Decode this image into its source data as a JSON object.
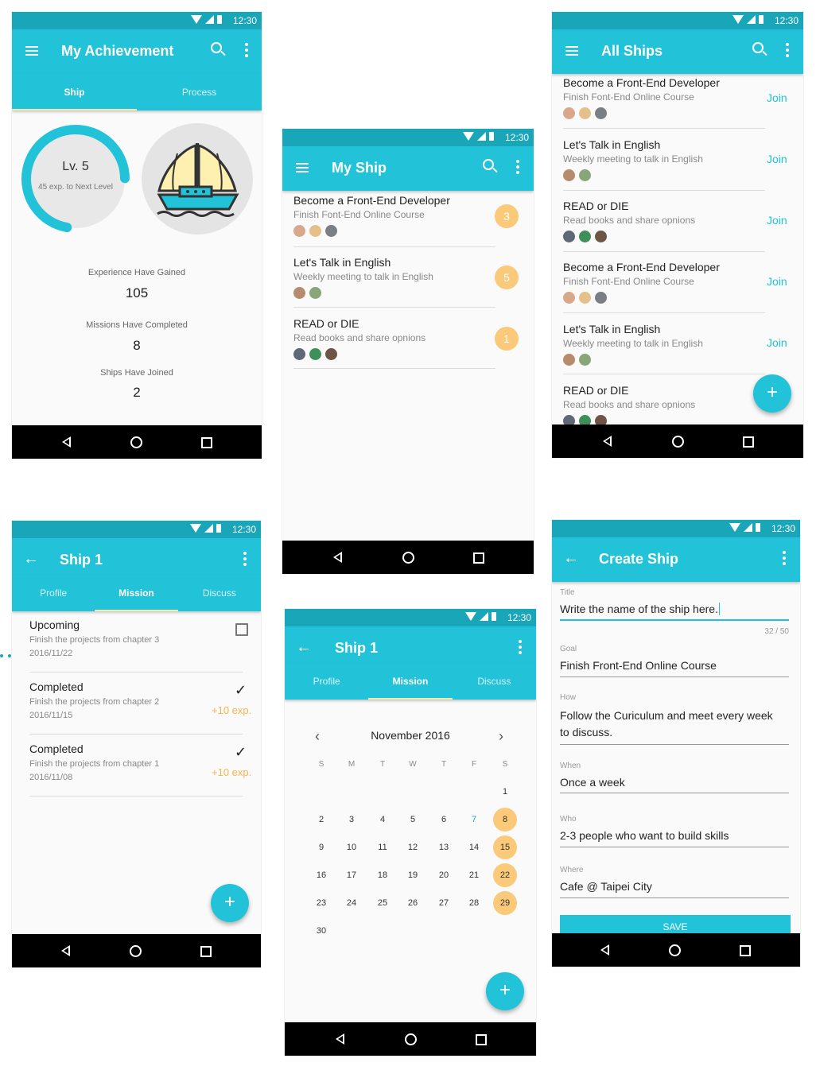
{
  "status_time": "12:30",
  "achievement": {
    "title": "My Achievement",
    "tabs": [
      "Ship",
      "Process"
    ],
    "level": "Lv. 5",
    "next_level": "45 exp. to Next Level",
    "level_progress": 0.72,
    "stats": [
      {
        "label": "Experience Have Gained",
        "value": "105"
      },
      {
        "label": "Missions Have Completed",
        "value": "8"
      },
      {
        "label": "Ships Have Joined",
        "value": "2"
      }
    ]
  },
  "my_ship": {
    "title": "My Ship",
    "items": [
      {
        "title": "Become a Front-End Developer",
        "sub": "Finish Font-End Online Course",
        "badge": "3"
      },
      {
        "title": "Let's Talk in English",
        "sub": "Weekly meeting to talk in English",
        "badge": "5"
      },
      {
        "title": "READ or DIE",
        "sub": "Read books and share opnions",
        "badge": "1"
      }
    ]
  },
  "all_ships": {
    "title": "All Ships",
    "join_label": "Join",
    "items": [
      {
        "title": "Become a Front-End Developer",
        "sub": "Finish Font-End Online Course"
      },
      {
        "title": "Let's Talk in English",
        "sub": "Weekly meeting to talk in English"
      },
      {
        "title": "READ or DIE",
        "sub": "Read books and share opnions"
      },
      {
        "title": "Become a Front-End Developer",
        "sub": "Finish Font-End Online Course"
      },
      {
        "title": "Let's Talk in English",
        "sub": "Weekly meeting to talk in English"
      },
      {
        "title": "READ or DIE",
        "sub": "Read books and share opnions"
      }
    ]
  },
  "ship1_mission": {
    "title": "Ship 1",
    "tabs": [
      "Profile",
      "Mission",
      "Discuss"
    ],
    "items": [
      {
        "status": "Upcoming",
        "desc": "Finish the projects from chapter 3",
        "date": "2016/11/22",
        "exp": ""
      },
      {
        "status": "Completed",
        "desc": "Finish the projects from chapter 2",
        "date": "2016/11/15",
        "exp": "+10 exp."
      },
      {
        "status": "Completed",
        "desc": "Finish the projects from chapter 1",
        "date": "2016/11/08",
        "exp": "+10 exp."
      }
    ],
    "fab": "+"
  },
  "ship1_calendar": {
    "title": "Ship 1",
    "tabs": [
      "Profile",
      "Mission",
      "Discuss"
    ],
    "month": "November 2016",
    "weekdays": [
      "S",
      "M",
      "T",
      "W",
      "T",
      "F",
      "S"
    ],
    "days": [
      "1",
      "2",
      "3",
      "4",
      "5",
      "6",
      "7",
      "8",
      "9",
      "10",
      "11",
      "12",
      "13",
      "14",
      "15",
      "16",
      "17",
      "18",
      "19",
      "20",
      "21",
      "22",
      "23",
      "24",
      "25",
      "26",
      "27",
      "28",
      "29",
      "30"
    ],
    "highlighted": [
      "8",
      "15",
      "22",
      "29"
    ],
    "today": "7",
    "fab": "+"
  },
  "create_ship": {
    "title": "Create Ship",
    "fields": [
      {
        "label": "Title",
        "value": "Write the name of the ship here."
      },
      {
        "label": "Goal",
        "value": "Finish Front-End Online Course"
      },
      {
        "label": "How",
        "value": "Follow the Curiculum and meet every week to discuss."
      },
      {
        "label": "When",
        "value": "Once a week"
      },
      {
        "label": "Who",
        "value": "2-3 people who want to build skills"
      },
      {
        "label": "Where",
        "value": "Cafe @ Taipei City"
      }
    ],
    "counter": "32 / 50",
    "save": "SAVE"
  },
  "colors": {
    "primary": "#22c2d8",
    "dark": "#1aa6b9",
    "accent": "#fbc97a"
  }
}
